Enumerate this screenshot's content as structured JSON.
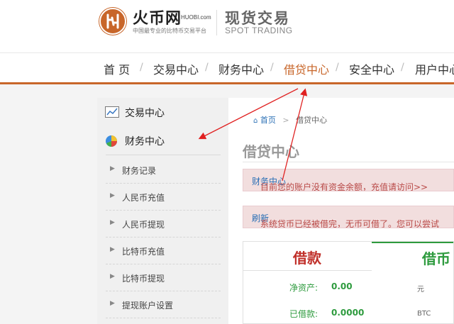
{
  "header": {
    "brand_cn": "火币网",
    "brand_en": "HUOBI.com",
    "slogan": "中国最专业的比特币交易平台",
    "spot_cn": "现货交易",
    "spot_en": "SPOT TRADING"
  },
  "nav": {
    "items": [
      {
        "label": "首 页"
      },
      {
        "label": "交易中心"
      },
      {
        "label": "财务中心"
      },
      {
        "label": "借贷中心"
      },
      {
        "label": "安全中心"
      },
      {
        "label": "用户中心"
      }
    ],
    "separator": "/",
    "accent": "#c8662a"
  },
  "sidebar": {
    "trading": "交易中心",
    "finance": "财务中心",
    "items": [
      {
        "label": "财务记录"
      },
      {
        "label": "人民币充值"
      },
      {
        "label": "人民币提现"
      },
      {
        "label": "比特币充值"
      },
      {
        "label": "比特币提现"
      },
      {
        "label": "提现账户设置"
      }
    ]
  },
  "breadcrumb": {
    "home": "首页",
    "sep": ">",
    "current": "借贷中心"
  },
  "page": {
    "title": "借贷中心"
  },
  "alerts": {
    "first_text": "目前您的账户没有资金余额，充值请访问>> ",
    "first_link": "财务中心",
    "second_text": "系统贷币已经被借完，无币可借了。您可以尝试",
    "second_link": "刷新"
  },
  "panel": {
    "tab_loan": "借款",
    "tab_coin": "借币",
    "net_assets_label": "净资产:",
    "net_assets_value": "0.00",
    "net_assets_unit": "元",
    "borrowed_label": "已借款:",
    "borrowed_value": "0.0000",
    "borrowed_unit": "BTC"
  },
  "colors": {
    "accent": "#c8662a",
    "green": "#2e9b3e",
    "red": "#c0302a",
    "link": "#2a6fb5",
    "annotation": "#e02020"
  }
}
